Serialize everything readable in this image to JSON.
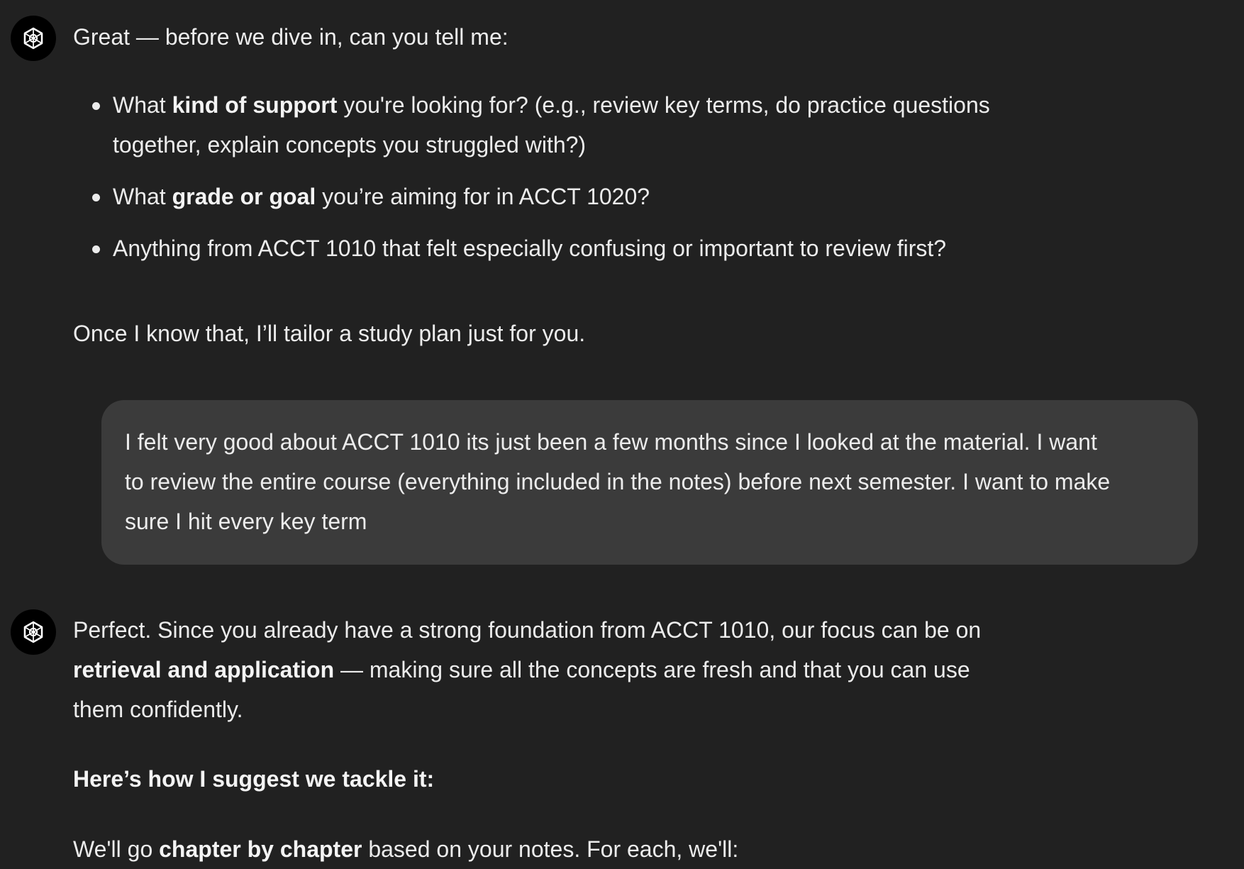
{
  "msg1": {
    "intro": "Great — before we dive in, can you tell me:",
    "b1_pre": "What ",
    "b1_bold": "kind of support",
    "b1_post": " you're looking for? (e.g., review key terms, do practice questions",
    "b1_line2": "together, explain concepts you struggled with?)",
    "b2_pre": "What ",
    "b2_bold": "grade or goal",
    "b2_post": " you’re aiming for in ACCT 1020?",
    "b3": "Anything from ACCT 1010 that felt especially confusing or important to review first?",
    "outro": "Once I know that, I’ll tailor a study plan just for you."
  },
  "user_msg": {
    "line1": "I felt very good about ACCT 1010 its just been a few months since I looked at the material. I want",
    "line2": "to review the entire course (everything included in the notes) before next semester. I want to make",
    "line3": "sure I hit every key term"
  },
  "msg2": {
    "p1_line1": "Perfect. Since you already have a strong foundation from ACCT 1010, our focus can be on",
    "p1_bold": "retrieval and application",
    "p1_line2_post": " — making sure all the concepts are fresh and that you can use",
    "p1_line3": "them confidently.",
    "heading": "Here’s how I suggest we tackle it:",
    "p3_pre": "We'll go ",
    "p3_bold": "chapter by chapter",
    "p3_post": " based on your notes. For each, we'll:"
  },
  "icons": {
    "assistant_avatar": "openai-logo-icon"
  }
}
